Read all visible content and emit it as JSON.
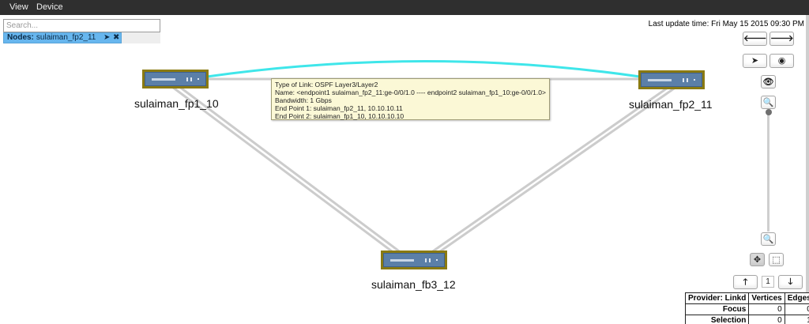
{
  "menu": {
    "items": [
      "View",
      "Device"
    ]
  },
  "search": {
    "placeholder": "Search..."
  },
  "selected_node": {
    "label": "Nodes:",
    "value": "sulaiman_fp2_11"
  },
  "last_update": "Last update time: Fri May 15 2015 09:30 PM",
  "nodes": [
    {
      "id": "fp1_10",
      "label": "sulaiman_fp1_10"
    },
    {
      "id": "fp2_11",
      "label": "sulaiman_fp2_11"
    },
    {
      "id": "fb3_12",
      "label": "sulaiman_fb3_12"
    }
  ],
  "tooltip": {
    "lines": [
      "Type of Link: OSPF Layer3/Layer2",
      "Name: <endpoint1 sulaiman_fp2_11:ge-0/0/1.0 ---- endpoint2 sulaiman_fp1_10:ge-0/0/1.0>",
      "Bandwidth: 1 Gbps",
      "End Point 1: sulaiman_fp2_11, 10.10.10.11",
      "End Point 2: sulaiman_fp1_10, 10.10.10.10"
    ]
  },
  "controls": {
    "pan_left": "🡐",
    "pan_right": "🡒",
    "locate": "➤",
    "globe": "◉",
    "eye": "👁",
    "zoom_in": "🔍",
    "zoom_out": "🔍",
    "move": "✥",
    "select": "⬚",
    "page_up": "🡑",
    "page_down": "🡓",
    "page_number": "1"
  },
  "icons": {
    "chip_locate": "➤",
    "chip_close": "✖"
  },
  "colors": {
    "highlight_link": "#3fe6ea",
    "link": "#cccccc",
    "device_frame": "#8a7a12",
    "device_body": "#5b7fa8",
    "chip_bg": "#67b6ee",
    "tooltip_bg": "#fbf8d6"
  },
  "stats": {
    "headers": [
      "Provider: Linkd",
      "Vertices",
      "Edges"
    ],
    "rows": [
      {
        "label": "Focus",
        "vertices": "0",
        "edges": "0"
      },
      {
        "label": "Selection",
        "vertices": "0",
        "edges": "1"
      }
    ]
  }
}
